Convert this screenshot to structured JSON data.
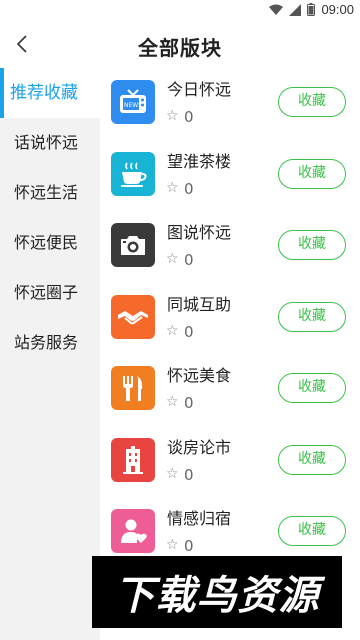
{
  "status": {
    "time": "09:00"
  },
  "header": {
    "title": "全部版块"
  },
  "sidebar": {
    "items": [
      {
        "label": "推荐收藏",
        "active": true
      },
      {
        "label": "话说怀远"
      },
      {
        "label": "怀远生活"
      },
      {
        "label": "怀远便民"
      },
      {
        "label": "怀远圈子"
      },
      {
        "label": "站务服务"
      }
    ]
  },
  "boards": [
    {
      "name": "今日怀远",
      "count": "0",
      "icon": "tv-news-icon",
      "color": "#2f8df0",
      "button": "收藏"
    },
    {
      "name": "望淮茶楼",
      "count": "0",
      "icon": "teacup-icon",
      "color": "#18b4d6",
      "button": "收藏"
    },
    {
      "name": "图说怀远",
      "count": "0",
      "icon": "camera-icon",
      "color": "#3a3a3a",
      "button": "收藏"
    },
    {
      "name": "同城互助",
      "count": "0",
      "icon": "handshake-icon",
      "color": "#f56a2a",
      "button": "收藏"
    },
    {
      "name": "怀远美食",
      "count": "0",
      "icon": "fork-knife-icon",
      "color": "#f27e22",
      "button": "收藏"
    },
    {
      "name": "谈房论市",
      "count": "0",
      "icon": "building-icon",
      "color": "#e94540",
      "button": "收藏"
    },
    {
      "name": "情感归宿",
      "count": "0",
      "icon": "person-heart-icon",
      "color": "#ef5d97",
      "button": "收藏"
    }
  ],
  "watermark": {
    "text": "下载鸟资源"
  }
}
